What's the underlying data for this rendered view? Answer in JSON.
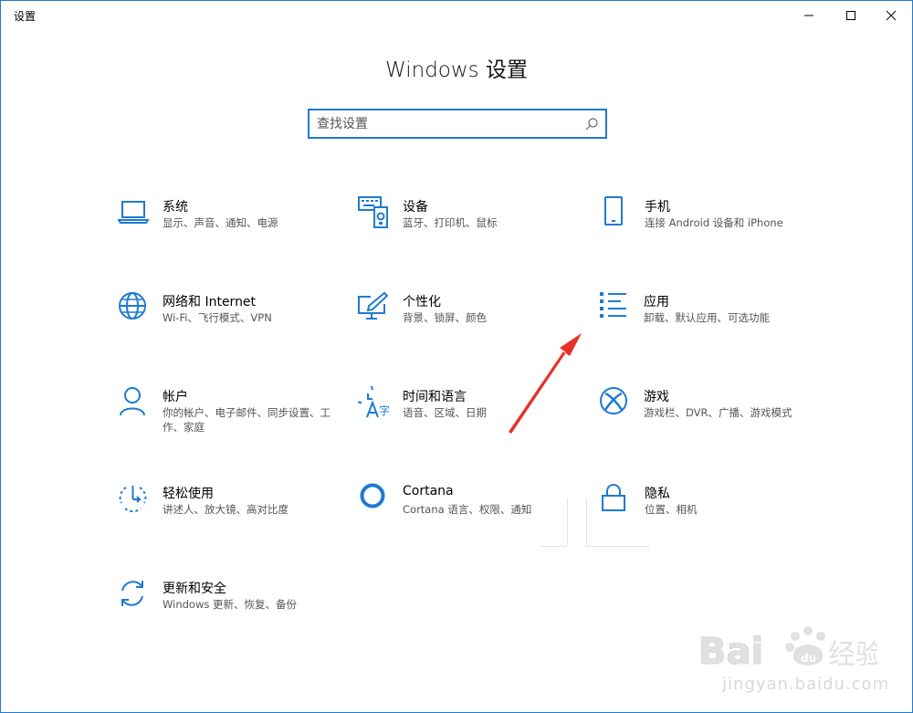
{
  "window": {
    "title": "设置",
    "minimize_label": "—",
    "maximize_label": "☐",
    "close_label": "✕"
  },
  "page": {
    "title": "Windows 设置"
  },
  "search": {
    "placeholder": "查找设置"
  },
  "tiles": [
    {
      "name": "系统",
      "desc": "显示、声音、通知、电源",
      "icon": "laptop-icon"
    },
    {
      "name": "设备",
      "desc": "蓝牙、打印机、鼠标",
      "icon": "keyboard-device-icon"
    },
    {
      "name": "手机",
      "desc": "连接 Android 设备和 iPhone",
      "icon": "phone-icon"
    },
    {
      "name": "网络和 Internet",
      "desc": "Wi-Fi、飞行模式、VPN",
      "icon": "globe-icon"
    },
    {
      "name": "个性化",
      "desc": "背景、锁屏、颜色",
      "icon": "paint-monitor-icon"
    },
    {
      "name": "应用",
      "desc": "卸载、默认应用、可选功能",
      "icon": "apps-list-icon"
    },
    {
      "name": "帐户",
      "desc": "你的帐户、电子邮件、同步设置、工作、家庭",
      "icon": "person-icon"
    },
    {
      "name": "时间和语言",
      "desc": "语音、区域、日期",
      "icon": "time-language-icon"
    },
    {
      "name": "游戏",
      "desc": "游戏栏、DVR、广播、游戏模式",
      "icon": "xbox-icon"
    },
    {
      "name": "轻松使用",
      "desc": "讲述人、放大镜、高对比度",
      "icon": "ease-of-access-icon"
    },
    {
      "name": "Cortana",
      "desc": "Cortana 语言、权限、通知",
      "icon": "cortana-icon"
    },
    {
      "name": "隐私",
      "desc": "位置、相机",
      "icon": "lock-icon"
    },
    {
      "name": "更新和安全",
      "desc": "Windows 更新、恢复、备份",
      "icon": "update-icon"
    }
  ],
  "watermark": {
    "text": "Bai 经验",
    "url": "jingyan.baidu.com"
  },
  "colors": {
    "accent": "#1f7ad1",
    "annotation_arrow": "#e8302a"
  }
}
